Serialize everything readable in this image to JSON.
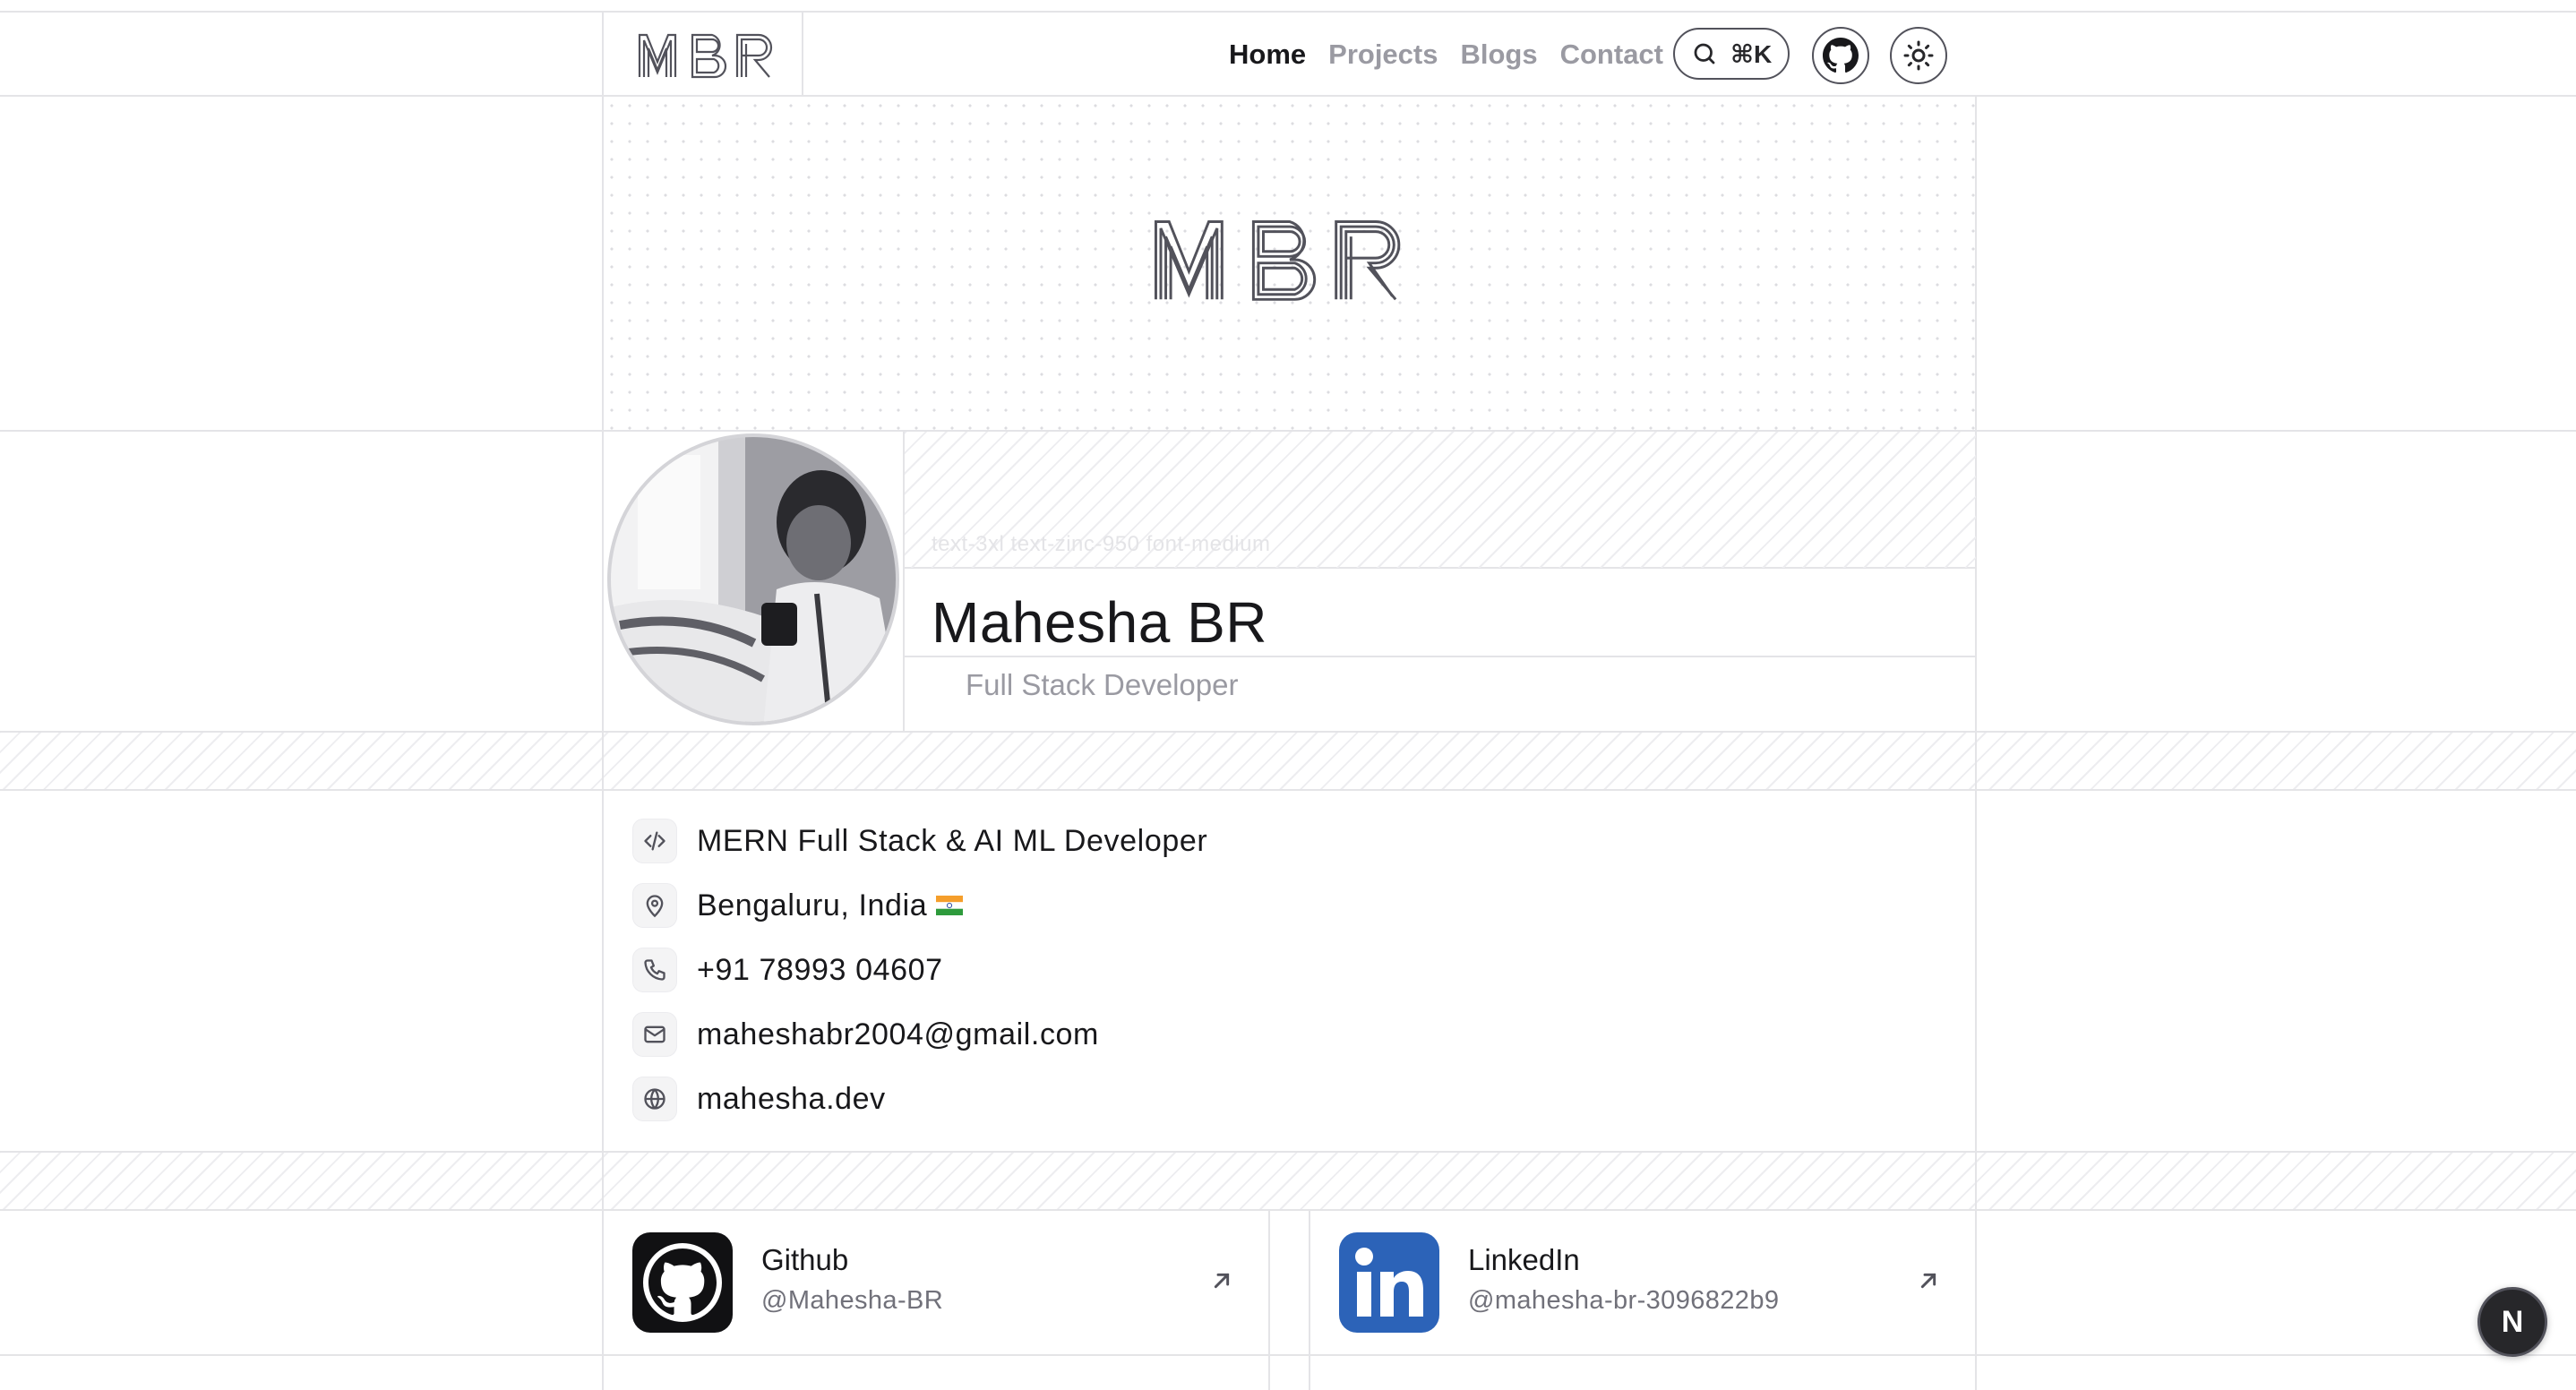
{
  "header": {
    "logo": "MBR",
    "nav": [
      {
        "label": "Home",
        "active": true
      },
      {
        "label": "Projects",
        "active": false
      },
      {
        "label": "Blogs",
        "active": false
      },
      {
        "label": "Contact",
        "active": false
      }
    ],
    "search_shortcut": "⌘K"
  },
  "banner": {
    "logo": "MBR"
  },
  "profile": {
    "class_hint": "text-3xl  text-zinc-950  font-medium",
    "name": "Mahesha BR",
    "role": "Full Stack Developer"
  },
  "info": [
    {
      "icon": "code-icon",
      "text": "MERN Full Stack & AI ML Developer"
    },
    {
      "icon": "map-pin-icon",
      "text": "Bengaluru, India"
    },
    {
      "icon": "phone-icon",
      "text": "+91 78993 04607"
    },
    {
      "icon": "mail-icon",
      "text": "maheshabr2004@gmail.com"
    },
    {
      "icon": "globe-icon",
      "text": "mahesha.dev"
    }
  ],
  "social": [
    {
      "title": "Github",
      "handle": "@Mahesha-BR"
    },
    {
      "title": "LinkedIn",
      "handle": "@mahesha-br-3096822b9"
    }
  ],
  "fab_label": "N",
  "colors": {
    "accent": "#18181b",
    "muted": "#9a9aa2",
    "linkedin": "#2c63b8",
    "border": "#e4e4e7"
  }
}
